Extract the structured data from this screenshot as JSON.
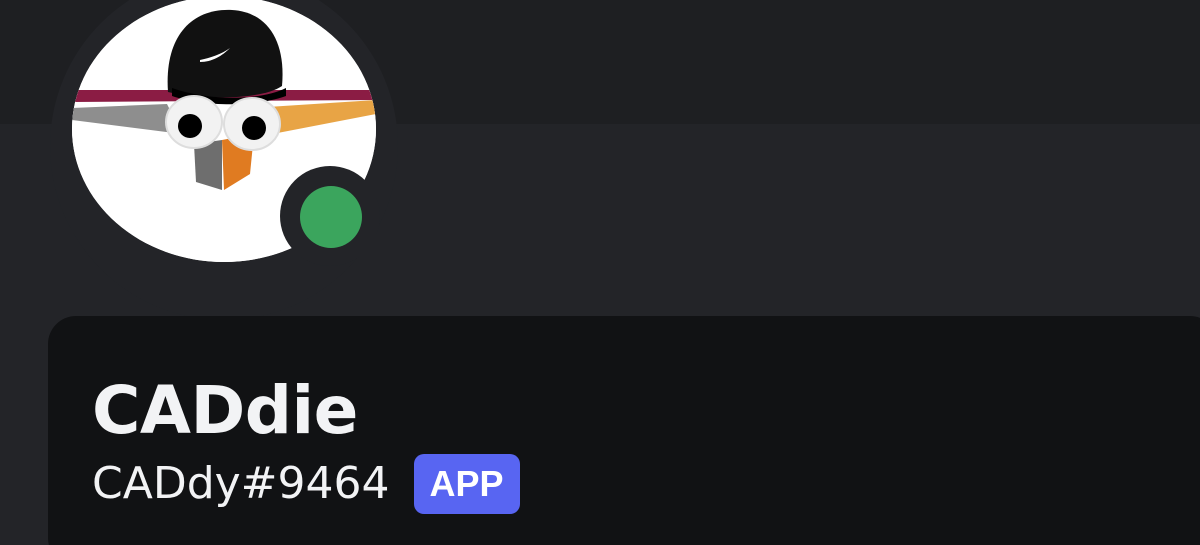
{
  "profile": {
    "display_name": "CADdie",
    "username": "CADdy#9464",
    "badge": "APP",
    "status": "online",
    "avatar_icon": "caddie-bot-avatar"
  },
  "colors": {
    "background": "#232428",
    "banner": "#1e1f22",
    "card": "#111214",
    "status_online": "#3ba55d",
    "badge": "#5865f2",
    "text_primary": "#f2f3f5"
  }
}
